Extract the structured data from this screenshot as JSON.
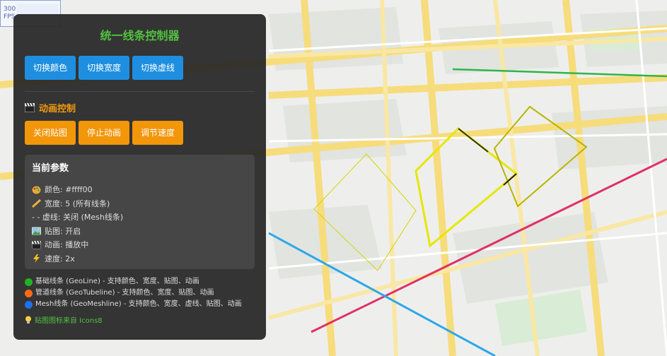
{
  "fps": {
    "value": "300",
    "unit": "FPS"
  },
  "panel": {
    "title": "统一线条控制器",
    "style_buttons": [
      "切换颜色",
      "切换宽度",
      "切换虚线"
    ],
    "animation_section_title": "动画控制",
    "animation_buttons": [
      "关闭贴图",
      "停止动画",
      "调节速度"
    ],
    "params_title": "当前参数",
    "params": {
      "color": "颜色: #ffff00",
      "width": "宽度: 5 (所有线条)",
      "dash": "- - 虚线: 关闭 (Mesh线条)",
      "texture": "贴图: 开启",
      "animation": "动画: 播放中",
      "speed": "速度: 2x"
    },
    "legend": [
      {
        "text": "基础线条 (GeoLine) - 支持颜色、宽度、贴图、动画",
        "color": "#1fb31f"
      },
      {
        "text": "管道线条 (GeoTubeline) - 支持颜色、宽度、贴图、动画",
        "color": "#ff6a1a"
      },
      {
        "text": "Mesh线条 (GeoMeshline) - 支持颜色、宽度、虚线、贴图、动画",
        "color": "#1a73e8"
      }
    ],
    "credit": "贴图图标来自 Icons8"
  },
  "colors": {
    "accent_green": "#52c041",
    "blue_button": "#1e8fe0",
    "orange_button": "#f2960a",
    "line_yellow": "#ffff00"
  },
  "icons": [
    "palette-icon",
    "ruler-icon",
    "clapper-icon",
    "picture-icon",
    "lightning-icon",
    "lightbulb-icon"
  ]
}
